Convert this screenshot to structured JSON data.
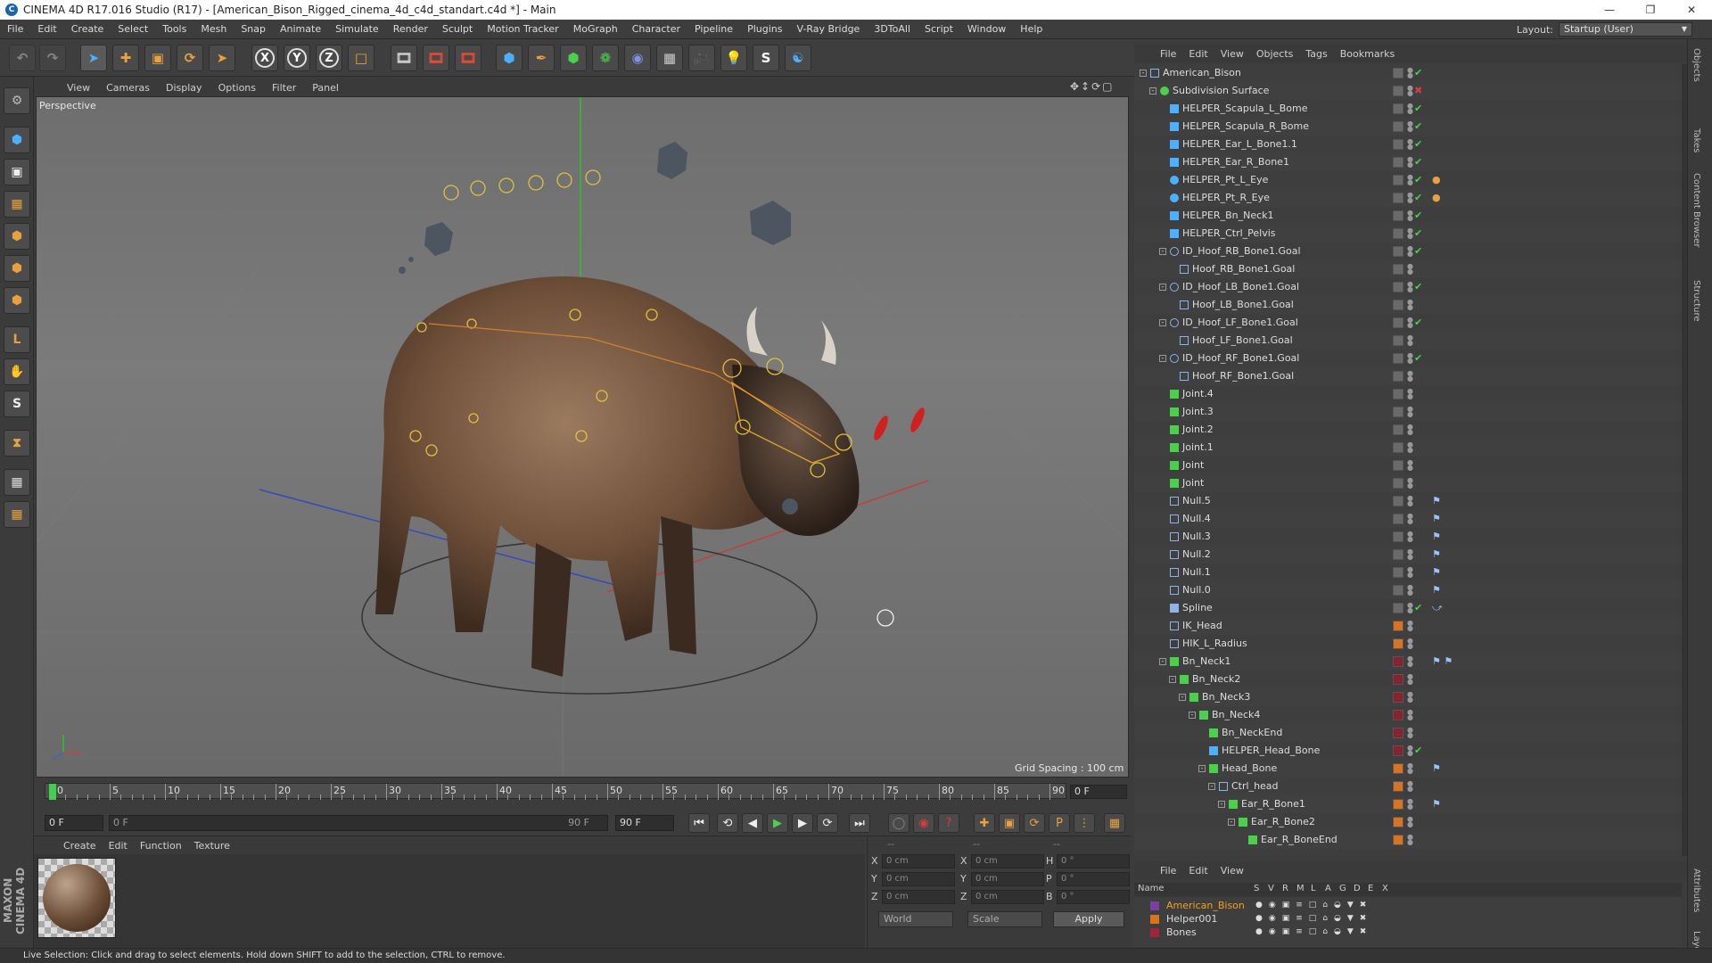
{
  "window": {
    "title": "CINEMA 4D R17.016 Studio (R17) - [American_Bison_Rigged_cinema_4d_c4d_standart.c4d *] - Main"
  },
  "menubar": [
    "File",
    "Edit",
    "Create",
    "Select",
    "Tools",
    "Mesh",
    "Snap",
    "Animate",
    "Simulate",
    "Render",
    "Sculpt",
    "Motion Tracker",
    "MoGraph",
    "Character",
    "Pipeline",
    "Plugins",
    "V-Ray Bridge",
    "3DToAll",
    "Script",
    "Window",
    "Help"
  ],
  "layout": {
    "label": "Layout:",
    "value": "Startup (User)"
  },
  "toolbar": {
    "axis_x": "X",
    "axis_y": "Y",
    "axis_z": "Z"
  },
  "viewport": {
    "menu": [
      "View",
      "Cameras",
      "Display",
      "Options",
      "Filter",
      "Panel"
    ],
    "label": "Perspective",
    "grid_spacing": "Grid Spacing : 100 cm"
  },
  "timeline": {
    "ticks": [
      "0",
      "5",
      "10",
      "15",
      "20",
      "25",
      "30",
      "35",
      "40",
      "45",
      "50",
      "55",
      "60",
      "65",
      "70",
      "75",
      "80",
      "85",
      "90"
    ],
    "current_frame": "0 F",
    "start_field": "0 F",
    "range_start": "0 F",
    "range_end": "90 F",
    "end_field": "90 F"
  },
  "material_manager": {
    "menu": [
      "Create",
      "Edit",
      "Function",
      "Texture"
    ]
  },
  "coordinates": {
    "header": [
      "--",
      "--",
      "--"
    ],
    "rows": [
      {
        "a": "X",
        "av": "0 cm",
        "b": "X",
        "bv": "0 cm",
        "c": "H",
        "cv": "0 °"
      },
      {
        "a": "Y",
        "av": "0 cm",
        "b": "Y",
        "bv": "0 cm",
        "c": "P",
        "cv": "0 °"
      },
      {
        "a": "Z",
        "av": "0 cm",
        "b": "Z",
        "bv": "0 cm",
        "c": "B",
        "cv": "0 °"
      }
    ],
    "world": "World",
    "scale": "Scale",
    "apply": "Apply"
  },
  "status": "Live Selection: Click and drag to select elements. Hold down SHIFT to add to the selection, CTRL to remove.",
  "object_manager": {
    "menu": [
      "File",
      "Edit",
      "View",
      "Objects",
      "Tags",
      "Bookmarks"
    ],
    "objects": [
      {
        "name": "American_Bison",
        "indent": 0,
        "icon": "null",
        "exp": "-",
        "tags": ""
      },
      {
        "name": "Subdivision Surface",
        "indent": 1,
        "icon": "subd",
        "exp": "-",
        "tags": ""
      },
      {
        "name": "HELPER_Scapula_L_Bome",
        "indent": 2,
        "icon": "helper",
        "exp": "",
        "tags": ""
      },
      {
        "name": "HELPER_Scapula_R_Bome",
        "indent": 2,
        "icon": "helper",
        "exp": "",
        "tags": ""
      },
      {
        "name": "HELPER_Ear_L_Bone1.1",
        "indent": 2,
        "icon": "helper",
        "exp": "",
        "tags": ""
      },
      {
        "name": "HELPER_Ear_R_Bone1",
        "indent": 2,
        "icon": "helper",
        "exp": "",
        "tags": ""
      },
      {
        "name": "HELPER_Pt_L_Eye",
        "indent": 2,
        "icon": "eye",
        "exp": "",
        "tags": "●"
      },
      {
        "name": "HELPER_Pt_R_Eye",
        "indent": 2,
        "icon": "eye",
        "exp": "",
        "tags": "●"
      },
      {
        "name": "HELPER_Bn_Neck1",
        "indent": 2,
        "icon": "helper",
        "exp": "",
        "tags": ""
      },
      {
        "name": "HELPER_Ctrl_Pelvis",
        "indent": 2,
        "icon": "helper",
        "exp": "",
        "tags": ""
      },
      {
        "name": "ID_Hoof_RB_Bone1.Goal",
        "indent": 2,
        "icon": "circle",
        "exp": "-",
        "tags": ""
      },
      {
        "name": "Hoof_RB_Bone1.Goal",
        "indent": 3,
        "icon": "null",
        "exp": "",
        "tags": ""
      },
      {
        "name": "ID_Hoof_LB_Bone1.Goal",
        "indent": 2,
        "icon": "circle",
        "exp": "-",
        "tags": ""
      },
      {
        "name": "Hoof_LB_Bone1.Goal",
        "indent": 3,
        "icon": "null",
        "exp": "",
        "tags": ""
      },
      {
        "name": "ID_Hoof_LF_Bone1.Goal",
        "indent": 2,
        "icon": "circle",
        "exp": "-",
        "tags": ""
      },
      {
        "name": "Hoof_LF_Bone1.Goal",
        "indent": 3,
        "icon": "null",
        "exp": "",
        "tags": ""
      },
      {
        "name": "ID_Hoof_RF_Bone1.Goal",
        "indent": 2,
        "icon": "circle",
        "exp": "-",
        "tags": ""
      },
      {
        "name": "Hoof_RF_Bone1.Goal",
        "indent": 3,
        "icon": "null",
        "exp": "",
        "tags": ""
      },
      {
        "name": "Joint.4",
        "indent": 2,
        "icon": "joint",
        "exp": "",
        "tags": ""
      },
      {
        "name": "Joint.3",
        "indent": 2,
        "icon": "joint",
        "exp": "",
        "tags": ""
      },
      {
        "name": "Joint.2",
        "indent": 2,
        "icon": "joint",
        "exp": "",
        "tags": ""
      },
      {
        "name": "Joint.1",
        "indent": 2,
        "icon": "joint",
        "exp": "",
        "tags": ""
      },
      {
        "name": "Joint",
        "indent": 2,
        "icon": "joint",
        "exp": "",
        "tags": ""
      },
      {
        "name": "Joint",
        "indent": 2,
        "icon": "joint",
        "exp": "",
        "tags": ""
      },
      {
        "name": "Null.5",
        "indent": 2,
        "icon": "null",
        "exp": "",
        "tags": "⚑"
      },
      {
        "name": "Null.4",
        "indent": 2,
        "icon": "null",
        "exp": "",
        "tags": "⚑"
      },
      {
        "name": "Null.3",
        "indent": 2,
        "icon": "null",
        "exp": "",
        "tags": "⚑"
      },
      {
        "name": "Null.2",
        "indent": 2,
        "icon": "null",
        "exp": "",
        "tags": "⚑"
      },
      {
        "name": "Null.1",
        "indent": 2,
        "icon": "null",
        "exp": "",
        "tags": "⚑"
      },
      {
        "name": "Null.0",
        "indent": 2,
        "icon": "null",
        "exp": "",
        "tags": "⚑"
      },
      {
        "name": "Spline",
        "indent": 2,
        "icon": "spline",
        "exp": "",
        "tags": "⤻"
      },
      {
        "name": "IK_Head",
        "indent": 2,
        "icon": "null",
        "exp": "",
        "tags": ""
      },
      {
        "name": "HIK_L_Radius",
        "indent": 2,
        "icon": "null",
        "exp": "",
        "tags": ""
      },
      {
        "name": "Bn_Neck1",
        "indent": 2,
        "icon": "joint",
        "exp": "-",
        "tags": "⚑ ⚑"
      },
      {
        "name": "Bn_Neck2",
        "indent": 3,
        "icon": "joint",
        "exp": "-",
        "tags": ""
      },
      {
        "name": "Bn_Neck3",
        "indent": 4,
        "icon": "joint",
        "exp": "-",
        "tags": ""
      },
      {
        "name": "Bn_Neck4",
        "indent": 5,
        "icon": "joint",
        "exp": "-",
        "tags": ""
      },
      {
        "name": "Bn_NeckEnd",
        "indent": 6,
        "icon": "joint",
        "exp": "",
        "tags": ""
      },
      {
        "name": "HELPER_Head_Bone",
        "indent": 6,
        "icon": "helper",
        "exp": "",
        "tags": ""
      },
      {
        "name": "Head_Bone",
        "indent": 6,
        "icon": "joint",
        "exp": "-",
        "tags": "⚑"
      },
      {
        "name": "Ctrl_head",
        "indent": 7,
        "icon": "null",
        "exp": "-",
        "tags": ""
      },
      {
        "name": "Ear_R_Bone1",
        "indent": 8,
        "icon": "joint",
        "exp": "-",
        "tags": "⚑"
      },
      {
        "name": "Ear_R_Bone2",
        "indent": 9,
        "icon": "joint",
        "exp": "-",
        "tags": ""
      },
      {
        "name": "Ear_R_BoneEnd",
        "indent": 10,
        "icon": "joint",
        "exp": "",
        "tags": ""
      }
    ]
  },
  "layer_manager": {
    "menu": [
      "File",
      "Edit",
      "View"
    ],
    "headers": [
      "Name",
      "S",
      "V",
      "R",
      "M",
      "L",
      "A",
      "G",
      "D",
      "E",
      "X"
    ],
    "layers": [
      {
        "name": "American_Bison",
        "color": "#7a3fa0",
        "highlight": true
      },
      {
        "name": "Helper001",
        "color": "#d9731f",
        "highlight": false
      },
      {
        "name": "Bones",
        "color": "#a3243a",
        "highlight": false
      }
    ]
  },
  "side_tabs": [
    "Objects",
    "Takes",
    "Content Browser",
    "Structure",
    "Attributes",
    "Layers"
  ],
  "brand": "MAXON CINEMA 4D",
  "colors": {
    "accent": "#e8a040",
    "selected_layer": "#f0a020",
    "check_green": "#4bd04b",
    "x_red": "#e03a3a"
  }
}
